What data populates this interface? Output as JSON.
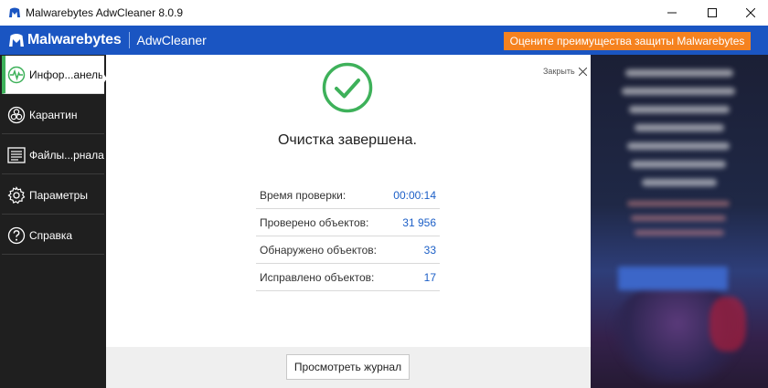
{
  "window": {
    "title": "Malwarebytes AdwCleaner 8.0.9"
  },
  "header": {
    "brand": "Malwarebytes",
    "product": "AdwCleaner",
    "promo_button": "Оцените преимущества защиты Malwarebytes"
  },
  "sidebar": {
    "items": [
      {
        "label": "Инфор...анель",
        "icon": "pulse-icon",
        "active": true
      },
      {
        "label": "Карантин",
        "icon": "biohazard-icon",
        "active": false
      },
      {
        "label": "Файлы...рнала",
        "icon": "log-file-icon",
        "active": false
      },
      {
        "label": "Параметры",
        "icon": "gear-icon",
        "active": false
      },
      {
        "label": "Справка",
        "icon": "help-icon",
        "active": false
      }
    ]
  },
  "main": {
    "close_label": "Закрыть",
    "heading": "Очистка завершена.",
    "stats": [
      {
        "label": "Время проверки:",
        "value": "00:00:14"
      },
      {
        "label": "Проверено объектов:",
        "value": "31 956"
      },
      {
        "label": "Обнаружено объектов:",
        "value": "33"
      },
      {
        "label": "Исправлено объектов:",
        "value": "17"
      }
    ],
    "journal_button": "Просмотреть журнал"
  },
  "colors": {
    "header_blue": "#1a55c2",
    "promo_orange": "#f5821f",
    "success_green": "#3eb15a",
    "sidebar_dark": "#1f1f1f",
    "value_blue": "#1c5fc7"
  }
}
